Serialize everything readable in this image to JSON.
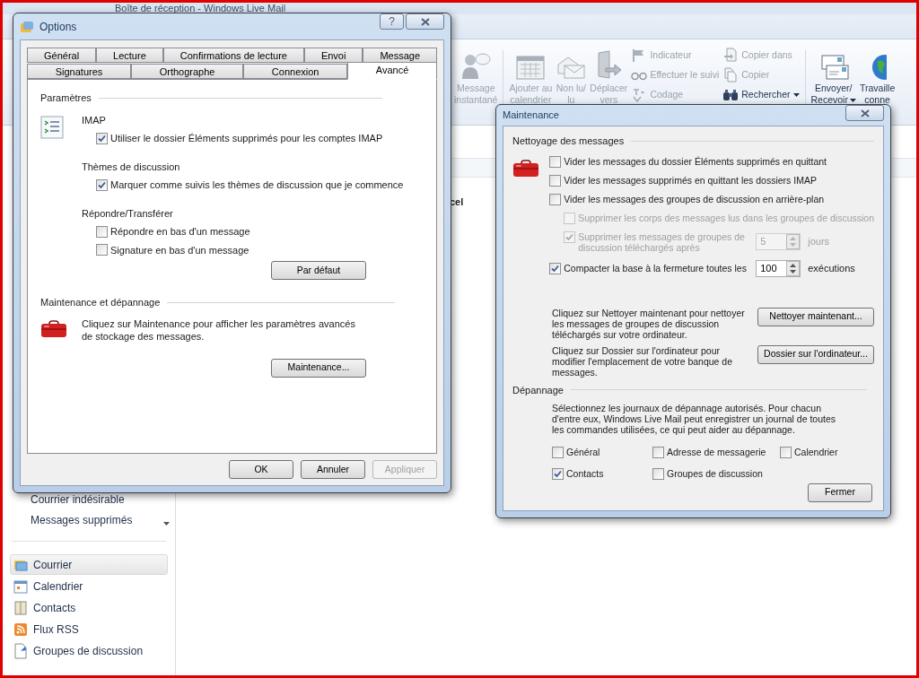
{
  "app": {
    "title": "Boîte de réception - Windows Live Mail",
    "ribbon": [
      {
        "kind": "large",
        "lines": [
          "Message",
          "instantané"
        ],
        "disabled": true,
        "dropdown": false
      },
      {
        "kind": "separator"
      },
      {
        "kind": "large",
        "lines": [
          "Ajouter au",
          "calendrier"
        ],
        "disabled": true,
        "dropdown": false
      },
      {
        "kind": "large",
        "lines": [
          "Non lu/",
          "lu"
        ],
        "disabled": true,
        "dropdown": false
      },
      {
        "kind": "large",
        "lines": [
          "Déplacer",
          "vers"
        ],
        "disabled": true,
        "dropdown": false
      },
      {
        "kind": "column",
        "items": [
          {
            "label": "Indicateur",
            "disabled": true,
            "dropdown": false
          },
          {
            "label": "Effectuer le suivi",
            "disabled": true,
            "dropdown": false
          },
          {
            "label": "Codage",
            "disabled": true,
            "dropdown": false
          }
        ]
      },
      {
        "kind": "column",
        "items": [
          {
            "label": "Copier dans",
            "disabled": true,
            "dropdown": false
          },
          {
            "label": "Copier",
            "disabled": true,
            "dropdown": false
          },
          {
            "label": "Rechercher",
            "disabled": false,
            "dropdown": true
          }
        ]
      },
      {
        "kind": "separator"
      },
      {
        "kind": "large",
        "lines": [
          "Envoyer/",
          "Recevoir"
        ],
        "disabled": false,
        "dropdown": true
      },
      {
        "kind": "large",
        "lines": [
          "Travaille",
          "conne"
        ],
        "disabled": false,
        "dropdown": false
      }
    ],
    "folders": [
      "Courrier indésirable",
      "Messages supprimés"
    ],
    "nav": [
      {
        "label": "Courrier",
        "selected": true
      },
      {
        "label": "Calendrier",
        "selected": false
      },
      {
        "label": "Contacts",
        "selected": false
      },
      {
        "label": "Flux RSS",
        "selected": false
      },
      {
        "label": "Groupes de discussion",
        "selected": false
      }
    ],
    "message_list": {
      "fragment": "cel"
    }
  },
  "options_dialog": {
    "title": "Options",
    "help": "?",
    "tab_rows": [
      [
        {
          "label": "Général",
          "selected": false
        },
        {
          "label": "Lecture",
          "selected": false
        },
        {
          "label": "Confirmations de lecture",
          "selected": false
        },
        {
          "label": "Envoi",
          "selected": false
        },
        {
          "label": "Message",
          "selected": false
        }
      ],
      [
        {
          "label": "Signatures",
          "selected": false
        },
        {
          "label": "Orthographe",
          "selected": false
        },
        {
          "label": "Connexion",
          "selected": false
        },
        {
          "label": "Avancé",
          "selected": true
        }
      ]
    ],
    "sections": [
      {
        "kind": "settings",
        "heading": "Paramètres",
        "groups": [
          {
            "heading": "IMAP",
            "options": [
              {
                "label": "Utiliser le dossier Éléments supprimés pour les comptes IMAP",
                "checked": true
              }
            ]
          },
          {
            "heading": "Thèmes de discussion",
            "options": [
              {
                "label": "Marquer comme suivis les thèmes de discussion que je commence",
                "checked": true
              }
            ]
          },
          {
            "heading": "Répondre/Transférer",
            "options": [
              {
                "label": "Répondre en bas d'un message",
                "checked": false
              },
              {
                "label": "Signature en bas d'un message",
                "checked": false
              }
            ]
          }
        ],
        "button": "Par défaut"
      },
      {
        "kind": "info",
        "heading": "Maintenance et dépannage",
        "text": "Cliquez sur Maintenance pour afficher les paramètres avancés de stockage des messages.",
        "button": "Maintenance..."
      }
    ],
    "buttons": [
      {
        "label": "OK",
        "disabled": false
      },
      {
        "label": "Annuler",
        "disabled": false
      },
      {
        "label": "Appliquer",
        "disabled": true
      }
    ]
  },
  "maintenance_dialog": {
    "title": "Maintenance",
    "cleanup": {
      "heading": "Nettoyage des messages",
      "options": [
        {
          "label": "Vider les messages du dossier Éléments supprimés en quittant",
          "checked": false,
          "disabled": false
        },
        {
          "label": "Vider les messages supprimés en quittant les dossiers IMAP",
          "checked": false,
          "disabled": false
        },
        {
          "label": "Vider les messages des groupes de discussion en arrière-plan",
          "checked": false,
          "disabled": false,
          "children": [
            {
              "label": "Supprimer les corps des messages lus dans les groupes de discussion",
              "checked": false,
              "disabled": true
            },
            {
              "label": "Supprimer les messages de groupes de discussion téléchargés après",
              "checked": true,
              "disabled": true,
              "spinner": "5",
              "unit": "jours"
            }
          ]
        },
        {
          "label": "Compacter la base à la fermeture toutes les",
          "checked": true,
          "disabled": false,
          "spinner": "100",
          "unit": "exécutions"
        }
      ]
    },
    "actions": [
      {
        "text": "Cliquez sur Nettoyer maintenant pour nettoyer les messages de groupes de discussion téléchargés sur votre ordinateur.",
        "button": "Nettoyer maintenant..."
      },
      {
        "text": "Cliquez sur Dossier sur l'ordinateur pour modifier l'emplacement de votre banque de messages.",
        "button": "Dossier sur l'ordinateur..."
      }
    ],
    "troubleshooting": {
      "heading": "Dépannage",
      "text": "Sélectionnez les journaux de dépannage autorisés. Pour chacun d'entre eux, Windows Live Mail peut enregistrer un journal de toutes les commandes utilisées, ce qui peut aider au dépannage.",
      "logs": [
        {
          "label": "Général",
          "checked": false
        },
        {
          "label": "Adresse de messagerie",
          "checked": false
        },
        {
          "label": "Calendrier",
          "checked": false
        },
        {
          "label": "Contacts",
          "checked": true
        },
        {
          "label": "Groupes de discussion",
          "checked": false
        }
      ]
    },
    "close_button": "Fermer"
  }
}
